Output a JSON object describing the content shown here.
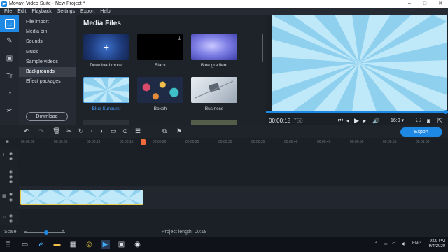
{
  "window": {
    "title": "Movavi Video Suite - New Project *",
    "controls": [
      "–",
      "□",
      "✕"
    ]
  },
  "menu": [
    "File",
    "Edit",
    "Playback",
    "Settings",
    "Export",
    "Help"
  ],
  "tools": [
    {
      "icon": "import-icon",
      "active": true
    },
    {
      "icon": "magic-wand-icon",
      "active": false
    },
    {
      "icon": "filters-icon",
      "active": false
    },
    {
      "icon": "titles-icon",
      "active": false
    },
    {
      "icon": "transitions-icon",
      "active": false
    },
    {
      "icon": "more-tools-icon",
      "active": false
    }
  ],
  "categories": [
    {
      "label": "File import"
    },
    {
      "label": "Media bin"
    },
    {
      "label": "Sounds"
    },
    {
      "label": "Music"
    },
    {
      "label": "Sample videos"
    },
    {
      "label": "Backgrounds",
      "selected": true
    },
    {
      "label": "Effect packages"
    }
  ],
  "download_button": "Download",
  "media": {
    "title": "Media Files",
    "tiles": [
      {
        "label": "Download more!",
        "icon": "plus-icon"
      },
      {
        "label": "Black",
        "icon": "download-icon"
      },
      {
        "label": "Blue gradient"
      },
      {
        "label": "Blue Sunburst",
        "selected": true
      },
      {
        "label": "Bokeh"
      },
      {
        "label": "Business"
      }
    ]
  },
  "preview": {
    "timecode": "00:00:18",
    "timecode_ms": ".750",
    "aspect": "16:9 ▾",
    "progress": 1.0
  },
  "export_button": "Export",
  "ruler_ticks": [
    "00:00:00",
    "00:00:05",
    "00:00:10",
    "00:00:15",
    "00:00:20",
    "00:00:25",
    "00:00:30",
    "00:00:35",
    "00:00:40",
    "00:00:45",
    "00:00:50",
    "00:00:55",
    "00:01:00"
  ],
  "status": {
    "scale_label": "Scale:",
    "project_length_label": "Project length:",
    "project_length_value": "00:18"
  },
  "taskbar": {
    "lang": "ENG",
    "time": "9:09 PM",
    "date": "9/4/2020"
  },
  "colors": {
    "accent": "#1e88e5",
    "playhead": "#f06a3c",
    "clip_border": "#e9c94b"
  }
}
